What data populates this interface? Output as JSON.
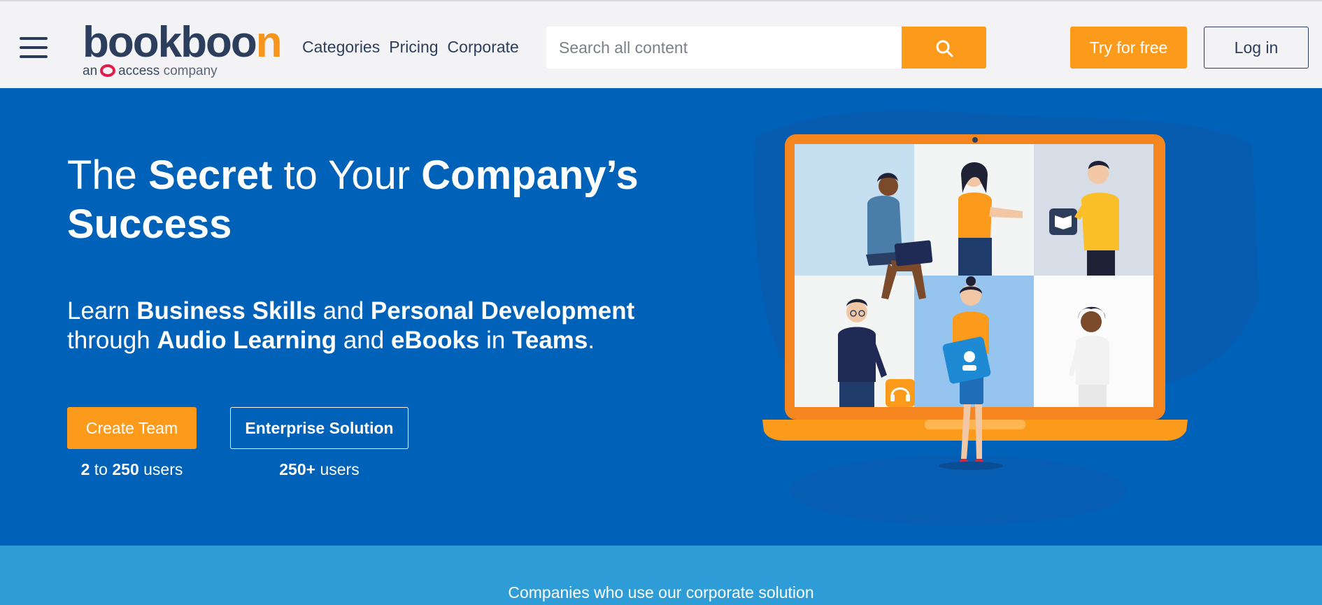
{
  "header": {
    "logo": {
      "word_main": "bookboo",
      "word_accent": "n",
      "sub_prefix": "an",
      "sub_brand": "access",
      "sub_suffix": "company"
    },
    "nav": [
      "Categories",
      "Pricing",
      "Corporate"
    ],
    "search": {
      "placeholder": "Search all content",
      "icon": "search-icon"
    },
    "try_label": "Try for free",
    "login_label": "Log in",
    "menu_icon": "hamburger-icon"
  },
  "hero": {
    "title": {
      "p1": "The ",
      "b1": "Secret",
      "p2": " to Your ",
      "b2": "Company’s Success"
    },
    "subtitle": {
      "p1": "Learn ",
      "b1": "Business Skills",
      "p2": " and ",
      "b2": "Personal Development",
      "p3": " through ",
      "b3": "Audio Learning",
      "p4": " and ",
      "b4": "eBooks",
      "p5": " in ",
      "b5": "Teams",
      "p6": "."
    },
    "create_team": {
      "label": "Create Team",
      "users_min": "2",
      "users_to": " to ",
      "users_max": "250",
      "users_word": " users"
    },
    "enterprise": {
      "label": "Enterprise Solution",
      "users_count": "250+",
      "users_word": " users"
    }
  },
  "clients": {
    "title": "Companies who use our corporate solution"
  },
  "colors": {
    "brand_navy": "#2c3e5c",
    "brand_orange": "#fb9a1b",
    "hero_blue": "#0061b8",
    "clients_blue": "#2e9cd6"
  }
}
